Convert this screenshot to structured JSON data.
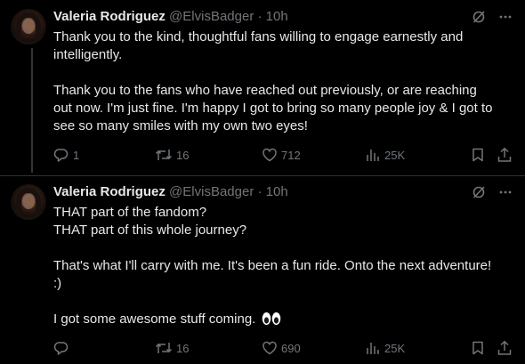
{
  "tweets": [
    {
      "author": {
        "display_name": "Valeria Rodriguez",
        "handle": "@ElvisBadger",
        "separator": "·",
        "time": "10h"
      },
      "paragraphs": [
        "Thank you to the kind, thoughtful fans willing to engage earnestly and intelligently.",
        "Thank you to the fans who have reached out previously, or are reaching out now. I'm just fine. I'm happy I got to bring so many people joy & I got to see so many smiles with my own two eyes!"
      ],
      "stats": {
        "replies": "1",
        "retweets": "16",
        "likes": "712",
        "views": "25K"
      }
    },
    {
      "author": {
        "display_name": "Valeria Rodriguez",
        "handle": "@ElvisBadger",
        "separator": "·",
        "time": "10h"
      },
      "paragraphs": [
        "THAT part of the fandom?\nTHAT part of this whole journey?",
        "That's what I'll carry with me. It's been a fun ride. Onto the next adventure! :)",
        "I got some awesome stuff coming."
      ],
      "stats": {
        "replies": "",
        "retweets": "16",
        "likes": "690",
        "views": "25K"
      }
    }
  ],
  "icons": {
    "grok": "grok-icon",
    "more": "more-icon",
    "reply": "reply-icon",
    "retweet": "retweet-icon",
    "like": "heart-icon",
    "views": "views-icon",
    "bookmark": "bookmark-icon",
    "share": "share-icon",
    "emoji": "eyes-emoji"
  },
  "colors": {
    "background": "#000000",
    "text_primary": "#e7e9ea",
    "text_secondary": "#71767b",
    "divider": "#2f3336"
  }
}
